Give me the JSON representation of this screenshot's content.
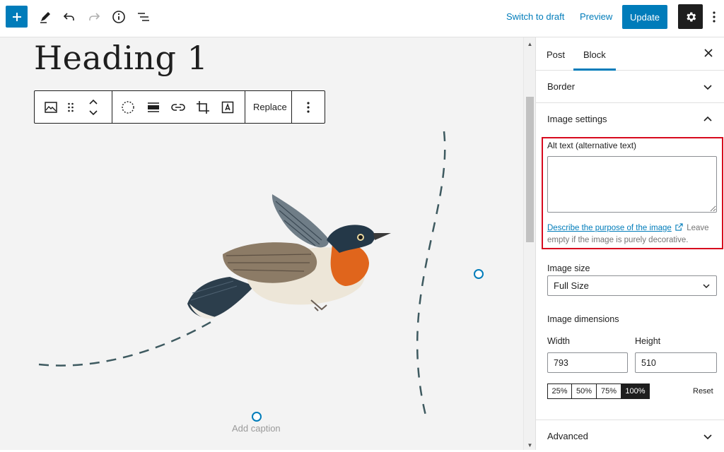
{
  "toolbar": {
    "switch_to_draft": "Switch to draft",
    "preview": "Preview",
    "update": "Update",
    "icons": [
      "plus-icon",
      "pen-icon",
      "undo-icon",
      "redo-icon",
      "info-icon",
      "list-view-icon",
      "gear-icon",
      "more-vertical-icon"
    ]
  },
  "editor": {
    "heading": "Heading 1",
    "block_toolbar": {
      "replace": "Replace",
      "icons": [
        "image-icon",
        "drag-handle-icon",
        "move-up-down-icon",
        "select-circle-icon",
        "align-icon",
        "link-icon",
        "crop-icon",
        "text-overlay-icon",
        "more-vertical-icon"
      ]
    },
    "caption_placeholder": "Add caption"
  },
  "sidebar": {
    "tabs": [
      {
        "label": "Post"
      },
      {
        "label": "Block",
        "active": true
      }
    ],
    "panels": {
      "border": "Border",
      "image_settings": "Image settings",
      "advanced": "Advanced"
    },
    "alt_text": {
      "label": "Alt text (alternative text)",
      "value": "",
      "link_text": "Describe the purpose of the image",
      "help_text": "Leave empty if the image is purely decorative."
    },
    "image_size": {
      "label": "Image size",
      "selected": "Full Size"
    },
    "dimensions": {
      "label": "Image dimensions",
      "width_label": "Width",
      "height_label": "Height",
      "width": "793",
      "height": "510",
      "presets": [
        "25%",
        "50%",
        "75%",
        "100%"
      ],
      "active_preset": "100%",
      "reset": "Reset"
    }
  },
  "colors": {
    "accent": "#007cba",
    "highlight": "#d70a1e",
    "dark": "#1e1e1e"
  }
}
